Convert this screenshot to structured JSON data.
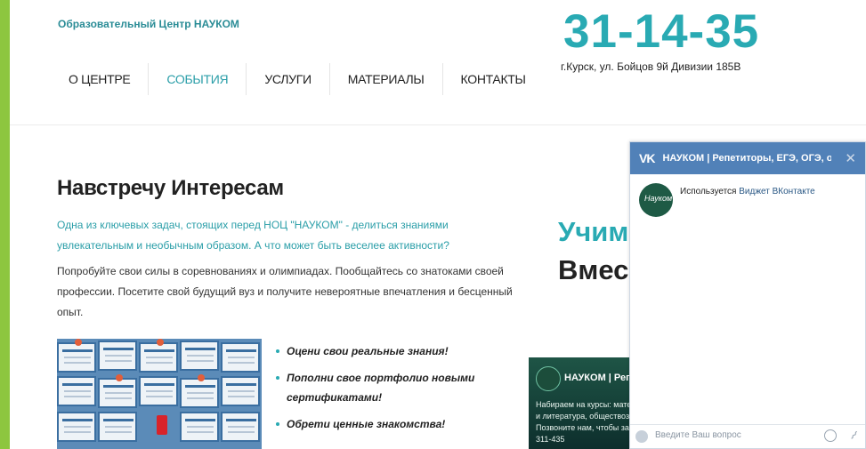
{
  "header": {
    "brand": "Образовательный Центр НАУКОМ",
    "phone": "31-14-35",
    "address": "г.Курск, ул. Бойцов 9й Дивизии 185В"
  },
  "nav": {
    "items": [
      "О ЦЕНТРЕ",
      "СОБЫТИЯ",
      "УСЛУГИ",
      "МАТЕРИАЛЫ",
      "КОНТАКТЫ"
    ],
    "active": "СОБЫТИЯ"
  },
  "main": {
    "title": "Навстречу Интересам",
    "lead_line1": "Одна из ключевых задач, стоящих перед НОЦ \"НАУКОМ\" - делиться знаниями",
    "lead_line2": "увлекательным и необычным образом. А что может быть веселее активности?",
    "body_line1": "Попробуйте свои силы в соревнованиях и олимпиадах. Пообщайтесь со знатоками своей",
    "body_line2": "профессии. Посетите свой будущий вуз и получите невероятные впечатления и бесценный",
    "body_line3": "опыт.",
    "bullets": [
      "Оцени свои реальные знания!",
      "Пополни свое портфолио новыми сертификатами!",
      "Обрети ценные знакомства!"
    ]
  },
  "side": {
    "title_line1": "Учимся",
    "title_line2": "Вместе",
    "post_name": "НАУКОМ | Репетиторы",
    "post_line1": "Набираем на курсы: математика, русский язык",
    "post_line2": "и литература, обществознание, история",
    "post_line3": "Позвоните нам, чтобы записаться",
    "post_line4": "311-435"
  },
  "vk": {
    "logo": "VK",
    "title": "НАУКОМ | Репетиторы, ЕГЭ, ОГЭ, ол...",
    "close": "✕",
    "avatar_text": "Науком",
    "msg_prefix": "Используется ",
    "msg_link": "Виджет ВКонтакте",
    "input_placeholder": "Введите Ваш вопрос"
  },
  "colors": {
    "accent": "#29aab3",
    "side_bar": "#8dc63f",
    "vk_blue": "#5181b8"
  }
}
